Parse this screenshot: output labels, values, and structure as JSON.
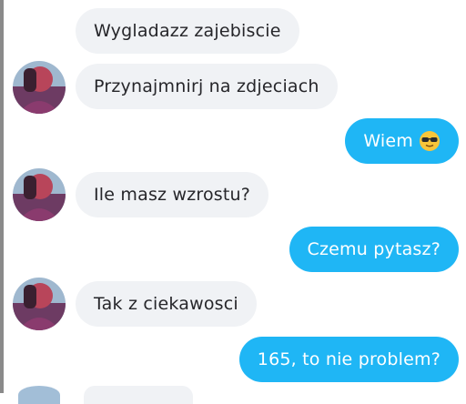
{
  "conversation": {
    "messages": [
      {
        "side": "incoming",
        "text": "Wygladazz zajebiscie"
      },
      {
        "side": "incoming",
        "text": "Przynajmnirj na zdjeciach"
      },
      {
        "side": "outgoing",
        "text": "Wiem"
      },
      {
        "side": "incoming",
        "text": "Ile masz wzrostu?"
      },
      {
        "side": "outgoing",
        "text": "Czemu pytasz?"
      },
      {
        "side": "incoming",
        "text": "Tak z ciekawosci"
      },
      {
        "side": "outgoing",
        "text": "165, to nie problem?"
      }
    ],
    "emoji_icon": "sunglasses-face-emoji",
    "colors": {
      "outgoing_bubble": "#1fb6f5",
      "incoming_bubble": "#f0f2f5",
      "incoming_text": "#26262a",
      "outgoing_text": "#ffffff"
    }
  }
}
